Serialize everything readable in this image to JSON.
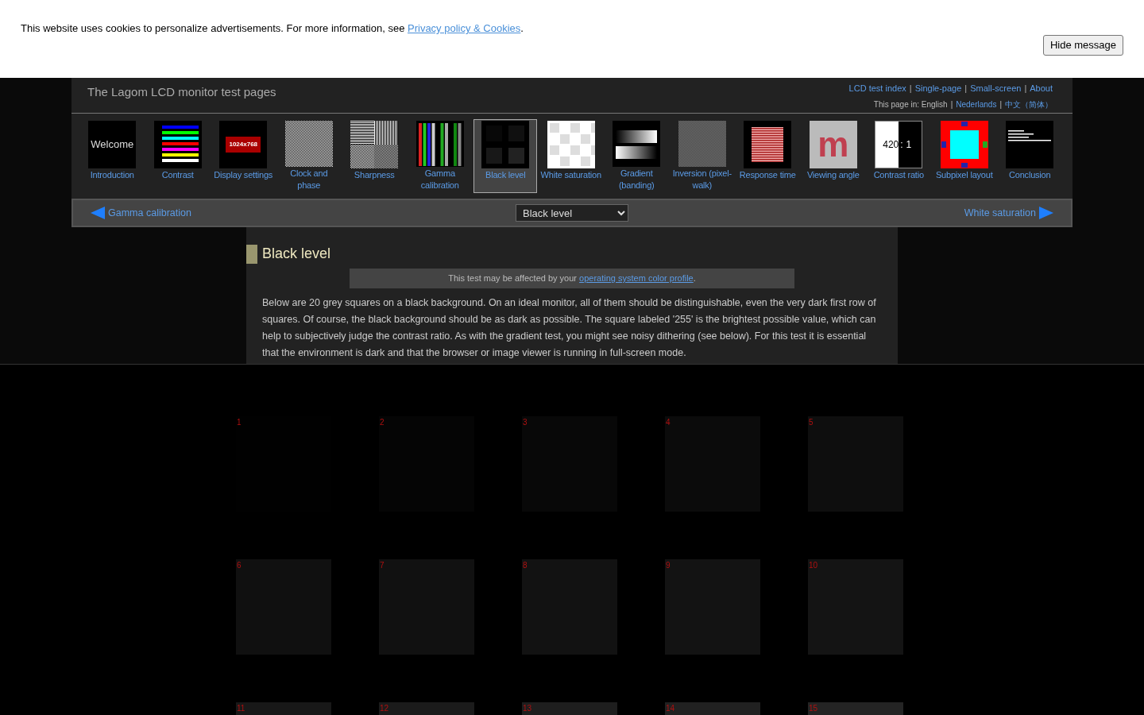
{
  "cookie_bar": {
    "text": "This website uses cookies to personalize advertisements. For more information, see ",
    "link": "Privacy policy & Cookies",
    "after": ".",
    "button": "Hide message"
  },
  "header": {
    "title": "The Lagom LCD monitor test pages",
    "links": [
      "LCD test index",
      "Single-page",
      "Small-screen",
      "About"
    ],
    "separator": "|",
    "language_label": "This page in: English",
    "languages": [
      "Nederlands",
      "中文（简体）"
    ]
  },
  "thumbnails": [
    {
      "kind": "welcome",
      "label": "Introduction",
      "text": "Welcome",
      "selected": false
    },
    {
      "kind": "contrast",
      "label": "Contrast",
      "selected": false
    },
    {
      "kind": "display",
      "label": "Display settings",
      "text": "1024x768",
      "selected": false
    },
    {
      "kind": "clock",
      "label": "Clock and phase",
      "selected": false
    },
    {
      "kind": "sharpness",
      "label": "Sharpness",
      "selected": false
    },
    {
      "kind": "gamma",
      "label": "Gamma calibration",
      "selected": false
    },
    {
      "kind": "black",
      "label": "Black level",
      "selected": true
    },
    {
      "kind": "white",
      "label": "White saturation",
      "selected": false
    },
    {
      "kind": "gradient",
      "label": "Gradient (banding)",
      "selected": false
    },
    {
      "kind": "inversion",
      "label": "Inversion (pixel-walk)",
      "selected": false
    },
    {
      "kind": "response",
      "label": "Response time",
      "selected": false
    },
    {
      "kind": "viewing",
      "label": "Viewing angle",
      "text": "m",
      "selected": false
    },
    {
      "kind": "ratio",
      "label": "Contrast ratio",
      "text": "420",
      "text2": ":",
      "text3": "1",
      "selected": false
    },
    {
      "kind": "subpixel",
      "label": "Subpixel layout",
      "selected": false
    },
    {
      "kind": "conclusion",
      "label": "Conclusion",
      "selected": false
    }
  ],
  "nav": {
    "previous": "Gamma calibration",
    "select": "Black level",
    "next": "White saturation"
  },
  "article": {
    "title": "Black level",
    "notice": "This test may be affected by your ",
    "notice_link": "operating system color profile",
    "notice_after": ".",
    "body": "Below are 20 grey squares on a black background. On an ideal monitor, all of them should be distinguishable, even the very dark first row of squares. Of course, the black background should be as dark as possible. The square labeled '255' is the brightest possible value, which can help to subjectively judge the contrast ratio. As with the gradient test, you might see noisy dithering (see below). For this test it is essential that the environment is dark and that the browser or image viewer is running in full-screen mode."
  },
  "squares": [
    {
      "label": "1",
      "color": "#010101"
    },
    {
      "label": "2",
      "color": "#050505"
    },
    {
      "label": "3",
      "color": "#080808"
    },
    {
      "label": "4",
      "color": "#0b0b0b"
    },
    {
      "label": "5",
      "color": "#0e0e0e"
    },
    {
      "label": "6",
      "color": "#101010"
    },
    {
      "label": "7",
      "color": "#111111"
    },
    {
      "label": "8",
      "color": "#121212"
    },
    {
      "label": "9",
      "color": "#131313"
    },
    {
      "label": "10",
      "color": "#141414"
    },
    {
      "label": "11",
      "color": "#181818"
    },
    {
      "label": "12",
      "color": "#1b1b1b"
    },
    {
      "label": "13",
      "color": "#1e1e1e"
    },
    {
      "label": "14",
      "color": "#212121"
    },
    {
      "label": "15",
      "color": "#242424"
    }
  ]
}
